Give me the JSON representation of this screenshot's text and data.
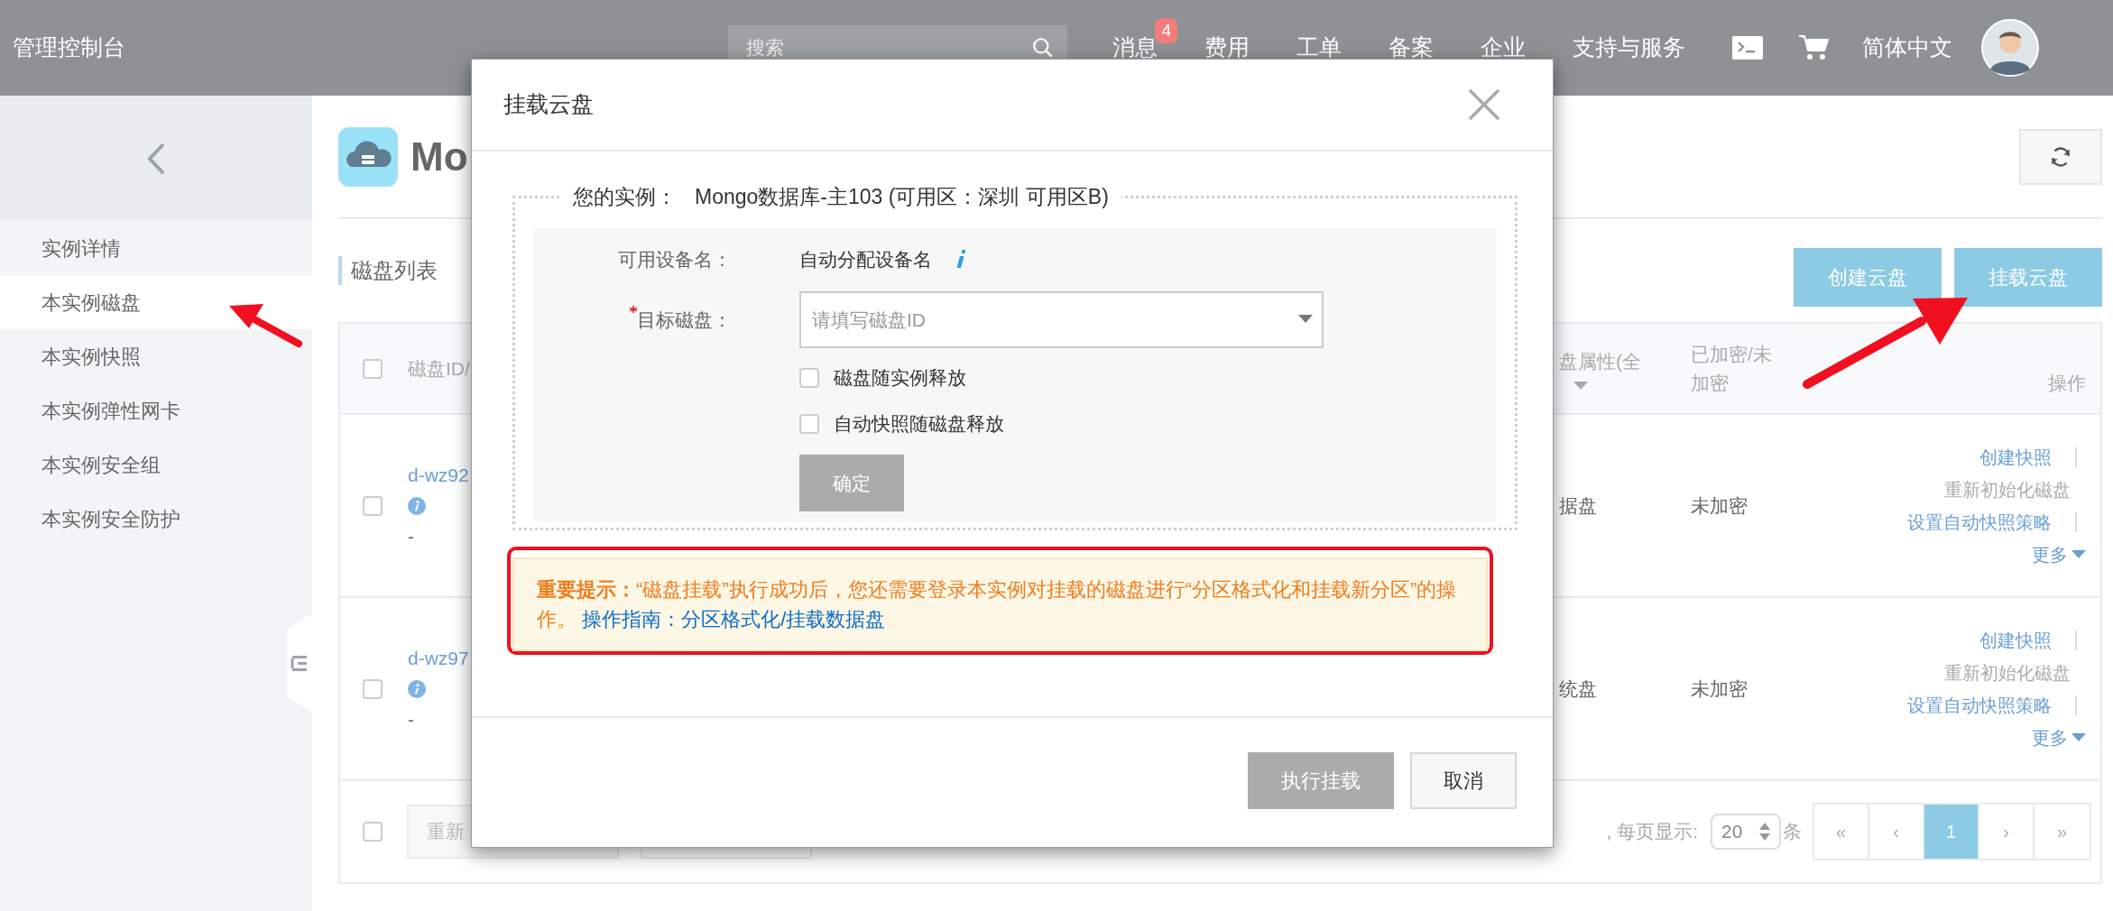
{
  "topbar": {
    "title": "管理控制台",
    "search": {
      "placeholder": "搜索"
    },
    "nav": [
      {
        "label": "消息",
        "badge": "4"
      },
      {
        "label": "费用"
      },
      {
        "label": "工单"
      },
      {
        "label": "备案"
      },
      {
        "label": "企业"
      },
      {
        "label": "支持与服务"
      }
    ],
    "language": "简体中文"
  },
  "sidebar": {
    "items": [
      {
        "label": "实例详情",
        "selected": false
      },
      {
        "label": "本实例磁盘",
        "selected": true
      },
      {
        "label": "本实例快照",
        "selected": false
      },
      {
        "label": "本实例弹性网卡",
        "selected": false
      },
      {
        "label": "本实例安全组",
        "selected": false
      },
      {
        "label": "本实例安全防护",
        "selected": false
      }
    ]
  },
  "page": {
    "title": "Mo",
    "section": "磁盘列表",
    "buttons": [
      "创建云盘",
      "挂载云盘"
    ]
  },
  "table": {
    "select_all": {
      "checked": false
    },
    "columns": [
      {
        "label": "磁盘ID/",
        "filter": false
      },
      {
        "label": "盘属性(全",
        "filter": true
      },
      {
        "label": "已加密/未加密",
        "filter": false
      },
      {
        "label": "操作",
        "filter": false
      }
    ],
    "rows": [
      {
        "checked": false,
        "id": "d-wz92",
        "note": "-",
        "attr": "据盘",
        "encrypted": "未加密",
        "actions": [
          {
            "label": "创建快照",
            "kind": "link",
            "disabled": false,
            "separator": true
          },
          {
            "label": "重新初始化磁盘",
            "kind": "link",
            "disabled": true,
            "separator": false
          },
          {
            "label": "设置自动快照策略",
            "kind": "link",
            "disabled": false,
            "separator": true
          },
          {
            "label": "更多",
            "kind": "menu",
            "disabled": false,
            "separator": false
          }
        ]
      },
      {
        "checked": false,
        "id": "d-wz97",
        "note": "-",
        "attr": "统盘",
        "encrypted": "未加密",
        "actions": [
          {
            "label": "创建快照",
            "kind": "link",
            "disabled": false,
            "separator": true
          },
          {
            "label": "重新初始化磁盘",
            "kind": "link",
            "disabled": true,
            "separator": false
          },
          {
            "label": "设置自动快照策略",
            "kind": "link",
            "disabled": false,
            "separator": true
          },
          {
            "label": "更多",
            "kind": "menu",
            "disabled": false,
            "separator": false
          }
        ]
      }
    ],
    "footer": {
      "checked": false,
      "button": "重新",
      "page_size_label": ", 每页显示:",
      "page_size": "20",
      "unit": "条",
      "pages": [
        {
          "label": "«",
          "selected": false
        },
        {
          "label": "‹",
          "selected": false
        },
        {
          "label": "1",
          "selected": true
        },
        {
          "label": "›",
          "selected": false
        },
        {
          "label": "»",
          "selected": false
        }
      ]
    }
  },
  "dialog": {
    "title": "挂载云盘",
    "instance_label": "您的实例：",
    "instance": "Mongo数据库-主103 (可用区：深圳 可用区B)",
    "fields": [
      {
        "kind": "text",
        "label": "可用设备名：",
        "value": "自动分配设备名",
        "required": false
      },
      {
        "kind": "select",
        "label": "目标磁盘：",
        "placeholder": "请填写磁盘ID",
        "required": true
      }
    ],
    "options": [
      {
        "label": "磁盘随实例释放",
        "checked": false
      },
      {
        "label": "自动快照随磁盘释放",
        "checked": false
      }
    ],
    "confirm": {
      "label": "确定",
      "disabled": true
    },
    "notice": {
      "text": "**重要提示：**“磁盘挂载”执行成功后，您还需要登录本实例对挂载的磁盘进行“分区格式化和挂载新分区”的操作。",
      "link": "操作指南：分区格式化/挂载数据盘"
    },
    "buttons": [
      {
        "label": "执行挂载",
        "disabled": true
      },
      {
        "label": "取消",
        "disabled": false
      }
    ]
  }
}
